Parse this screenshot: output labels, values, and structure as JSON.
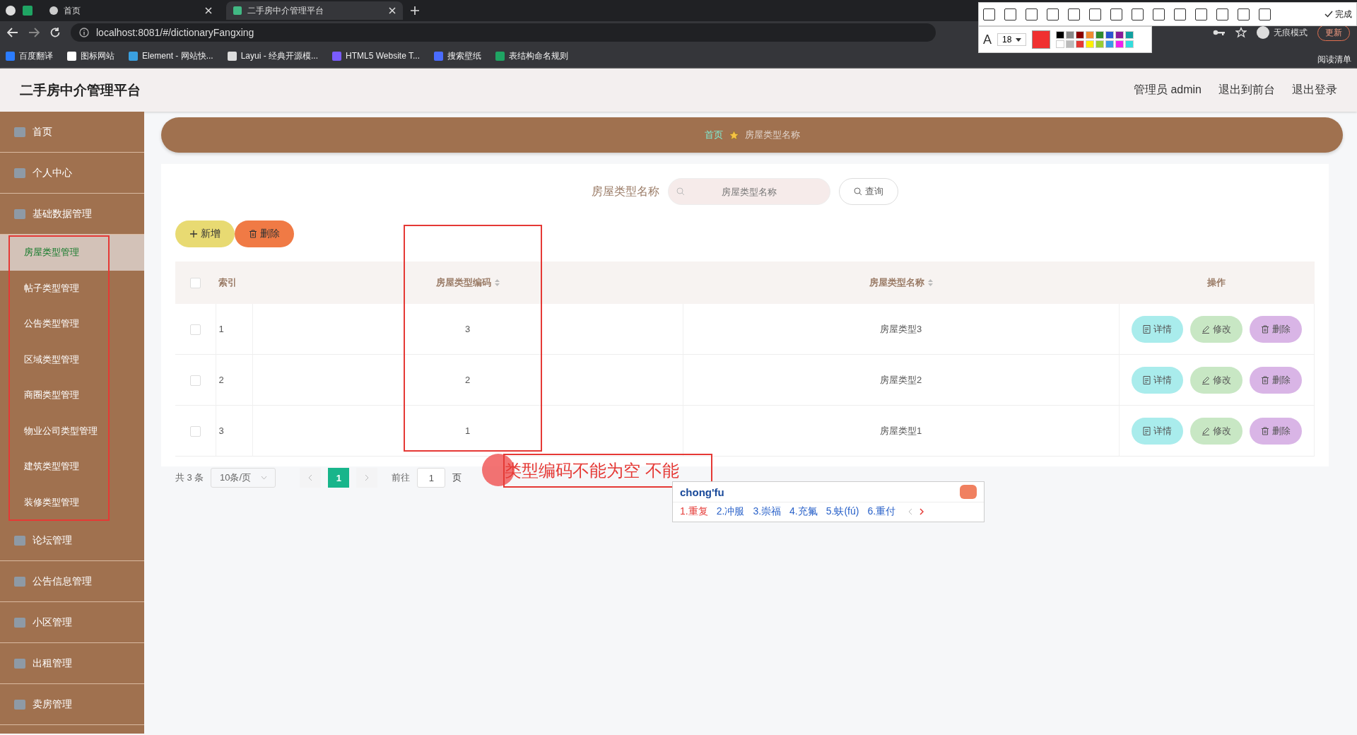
{
  "browser": {
    "tabs": [
      {
        "title": "首页",
        "selected": false
      },
      {
        "title": "二手房中介管理平台",
        "selected": true
      }
    ],
    "address": "localhost:8081/#/dictionaryFangxing",
    "bookmarks": [
      "百度翻译",
      "图标网站",
      "Element - 网站快...",
      "Layui - 经典开源模...",
      "HTML5 Website T...",
      "搜索壁纸",
      "表结构命名规则"
    ],
    "profile": "无痕模式",
    "update": "更新",
    "reading_list": "阅读清单"
  },
  "screenshot_toolbar": {
    "done": "完成",
    "font_label": "A",
    "font_size": "18"
  },
  "header": {
    "title": "二手房中介管理平台",
    "links": [
      "管理员 admin",
      "退出到前台",
      "退出登录"
    ]
  },
  "sidebar": {
    "items": [
      {
        "label": "首页",
        "selected": false
      },
      {
        "label": "个人中心",
        "selected": false
      },
      {
        "label": "基础数据管理",
        "selected": false,
        "children": [
          {
            "label": "房屋类型管理",
            "selected": true
          },
          {
            "label": "帖子类型管理",
            "selected": false
          },
          {
            "label": "公告类型管理",
            "selected": false
          },
          {
            "label": "区域类型管理",
            "selected": false
          },
          {
            "label": "商圈类型管理",
            "selected": false
          },
          {
            "label": "物业公司类型管理",
            "selected": false
          },
          {
            "label": "建筑类型管理",
            "selected": false
          },
          {
            "label": "装修类型管理",
            "selected": false
          }
        ]
      },
      {
        "label": "论坛管理",
        "selected": false
      },
      {
        "label": "公告信息管理",
        "selected": false
      },
      {
        "label": "小区管理",
        "selected": false
      },
      {
        "label": "出租管理",
        "selected": false
      },
      {
        "label": "卖房管理",
        "selected": false
      }
    ]
  },
  "breadcrumb": [
    "首页",
    "房屋类型名称"
  ],
  "search": {
    "label": "房屋类型名称",
    "placeholder": "房屋类型名称",
    "button": "查询"
  },
  "actions": [
    {
      "label": "新增",
      "kind": "add"
    },
    {
      "label": "删除",
      "kind": "delete"
    }
  ],
  "table": {
    "select_all_checked": false,
    "columns": [
      "索引",
      "房屋类型编码",
      "房屋类型名称",
      "操作"
    ],
    "rows": [
      {
        "index": "1",
        "code": "3",
        "name": "房屋类型3",
        "checked": false,
        "actions": [
          {
            "label": "详情",
            "kind": "detail"
          },
          {
            "label": "修改",
            "kind": "edit"
          },
          {
            "label": "删除",
            "kind": "delete"
          }
        ]
      },
      {
        "index": "2",
        "code": "2",
        "name": "房屋类型2",
        "checked": false,
        "actions": [
          {
            "label": "详情",
            "kind": "detail"
          },
          {
            "label": "修改",
            "kind": "edit"
          },
          {
            "label": "删除",
            "kind": "delete"
          }
        ]
      },
      {
        "index": "3",
        "code": "1",
        "name": "房屋类型1",
        "checked": false,
        "actions": [
          {
            "label": "详情",
            "kind": "detail"
          },
          {
            "label": "修改",
            "kind": "edit"
          },
          {
            "label": "删除",
            "kind": "delete"
          }
        ]
      }
    ]
  },
  "pagination": {
    "total": "共 3 条",
    "page_size": "10条/页",
    "pages": [
      {
        "label": "1",
        "selected": true
      }
    ],
    "goto_label": "前往",
    "goto_value": "1",
    "goto_suffix": "页"
  },
  "annotation": {
    "text": "类型编码不能为空 不能"
  },
  "ime": {
    "input": "chong'fu",
    "candidates": [
      {
        "label": "1.重复",
        "selected": true
      },
      {
        "label": "2.冲服",
        "selected": false
      },
      {
        "label": "3.崇福",
        "selected": false
      },
      {
        "label": "4.充氟",
        "selected": false
      },
      {
        "label": "5.蚨(fú)",
        "selected": false
      },
      {
        "label": "6.重付",
        "selected": false
      }
    ]
  }
}
